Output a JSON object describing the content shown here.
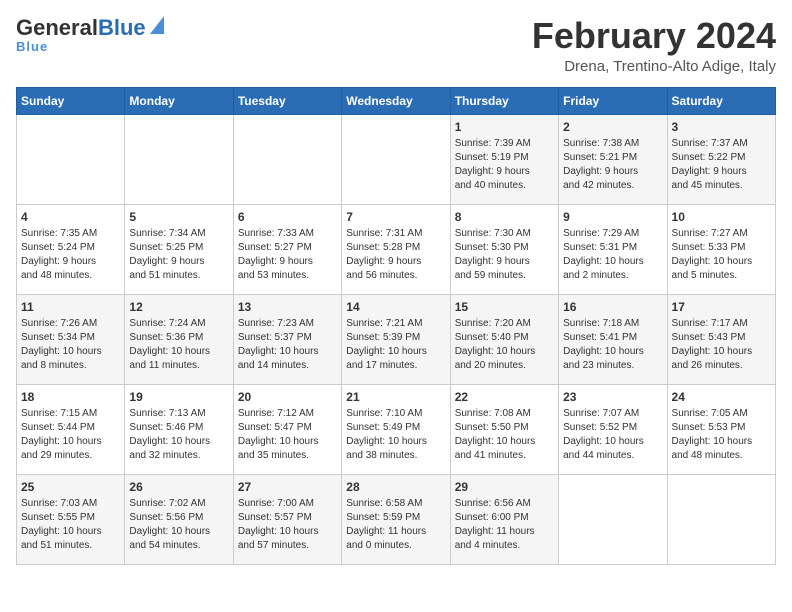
{
  "header": {
    "logo_general": "General",
    "logo_blue": "Blue",
    "title": "February 2024",
    "subtitle": "Drena, Trentino-Alto Adige, Italy"
  },
  "weekdays": [
    "Sunday",
    "Monday",
    "Tuesday",
    "Wednesday",
    "Thursday",
    "Friday",
    "Saturday"
  ],
  "weeks": [
    [
      {
        "day": "",
        "content": ""
      },
      {
        "day": "",
        "content": ""
      },
      {
        "day": "",
        "content": ""
      },
      {
        "day": "",
        "content": ""
      },
      {
        "day": "1",
        "content": "Sunrise: 7:39 AM\nSunset: 5:19 PM\nDaylight: 9 hours\nand 40 minutes."
      },
      {
        "day": "2",
        "content": "Sunrise: 7:38 AM\nSunset: 5:21 PM\nDaylight: 9 hours\nand 42 minutes."
      },
      {
        "day": "3",
        "content": "Sunrise: 7:37 AM\nSunset: 5:22 PM\nDaylight: 9 hours\nand 45 minutes."
      }
    ],
    [
      {
        "day": "4",
        "content": "Sunrise: 7:35 AM\nSunset: 5:24 PM\nDaylight: 9 hours\nand 48 minutes."
      },
      {
        "day": "5",
        "content": "Sunrise: 7:34 AM\nSunset: 5:25 PM\nDaylight: 9 hours\nand 51 minutes."
      },
      {
        "day": "6",
        "content": "Sunrise: 7:33 AM\nSunset: 5:27 PM\nDaylight: 9 hours\nand 53 minutes."
      },
      {
        "day": "7",
        "content": "Sunrise: 7:31 AM\nSunset: 5:28 PM\nDaylight: 9 hours\nand 56 minutes."
      },
      {
        "day": "8",
        "content": "Sunrise: 7:30 AM\nSunset: 5:30 PM\nDaylight: 9 hours\nand 59 minutes."
      },
      {
        "day": "9",
        "content": "Sunrise: 7:29 AM\nSunset: 5:31 PM\nDaylight: 10 hours\nand 2 minutes."
      },
      {
        "day": "10",
        "content": "Sunrise: 7:27 AM\nSunset: 5:33 PM\nDaylight: 10 hours\nand 5 minutes."
      }
    ],
    [
      {
        "day": "11",
        "content": "Sunrise: 7:26 AM\nSunset: 5:34 PM\nDaylight: 10 hours\nand 8 minutes."
      },
      {
        "day": "12",
        "content": "Sunrise: 7:24 AM\nSunset: 5:36 PM\nDaylight: 10 hours\nand 11 minutes."
      },
      {
        "day": "13",
        "content": "Sunrise: 7:23 AM\nSunset: 5:37 PM\nDaylight: 10 hours\nand 14 minutes."
      },
      {
        "day": "14",
        "content": "Sunrise: 7:21 AM\nSunset: 5:39 PM\nDaylight: 10 hours\nand 17 minutes."
      },
      {
        "day": "15",
        "content": "Sunrise: 7:20 AM\nSunset: 5:40 PM\nDaylight: 10 hours\nand 20 minutes."
      },
      {
        "day": "16",
        "content": "Sunrise: 7:18 AM\nSunset: 5:41 PM\nDaylight: 10 hours\nand 23 minutes."
      },
      {
        "day": "17",
        "content": "Sunrise: 7:17 AM\nSunset: 5:43 PM\nDaylight: 10 hours\nand 26 minutes."
      }
    ],
    [
      {
        "day": "18",
        "content": "Sunrise: 7:15 AM\nSunset: 5:44 PM\nDaylight: 10 hours\nand 29 minutes."
      },
      {
        "day": "19",
        "content": "Sunrise: 7:13 AM\nSunset: 5:46 PM\nDaylight: 10 hours\nand 32 minutes."
      },
      {
        "day": "20",
        "content": "Sunrise: 7:12 AM\nSunset: 5:47 PM\nDaylight: 10 hours\nand 35 minutes."
      },
      {
        "day": "21",
        "content": "Sunrise: 7:10 AM\nSunset: 5:49 PM\nDaylight: 10 hours\nand 38 minutes."
      },
      {
        "day": "22",
        "content": "Sunrise: 7:08 AM\nSunset: 5:50 PM\nDaylight: 10 hours\nand 41 minutes."
      },
      {
        "day": "23",
        "content": "Sunrise: 7:07 AM\nSunset: 5:52 PM\nDaylight: 10 hours\nand 44 minutes."
      },
      {
        "day": "24",
        "content": "Sunrise: 7:05 AM\nSunset: 5:53 PM\nDaylight: 10 hours\nand 48 minutes."
      }
    ],
    [
      {
        "day": "25",
        "content": "Sunrise: 7:03 AM\nSunset: 5:55 PM\nDaylight: 10 hours\nand 51 minutes."
      },
      {
        "day": "26",
        "content": "Sunrise: 7:02 AM\nSunset: 5:56 PM\nDaylight: 10 hours\nand 54 minutes."
      },
      {
        "day": "27",
        "content": "Sunrise: 7:00 AM\nSunset: 5:57 PM\nDaylight: 10 hours\nand 57 minutes."
      },
      {
        "day": "28",
        "content": "Sunrise: 6:58 AM\nSunset: 5:59 PM\nDaylight: 11 hours\nand 0 minutes."
      },
      {
        "day": "29",
        "content": "Sunrise: 6:56 AM\nSunset: 6:00 PM\nDaylight: 11 hours\nand 4 minutes."
      },
      {
        "day": "",
        "content": ""
      },
      {
        "day": "",
        "content": ""
      }
    ]
  ]
}
